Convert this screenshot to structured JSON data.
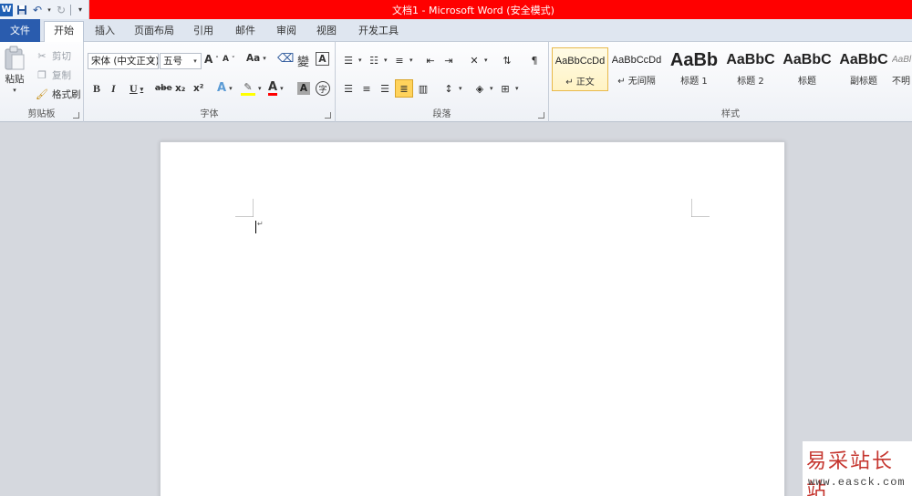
{
  "window": {
    "title": "文档1  -  Microsoft Word (安全模式)",
    "logo_letter": "W",
    "title_bar_color": "#ff0000"
  },
  "tabs": {
    "file": "文件",
    "home": "开始",
    "insert": "插入",
    "layout": "页面布局",
    "references": "引用",
    "mailings": "邮件",
    "review": "审阅",
    "view": "视图",
    "developer": "开发工具"
  },
  "clipboard": {
    "paste": "粘贴",
    "cut": "剪切",
    "copy": "复制",
    "format_painter": "格式刷",
    "label": "剪贴板"
  },
  "font": {
    "family": "宋体 (中文正文)",
    "size": "五号",
    "grow": "A",
    "shrink": "A",
    "case": "Aa",
    "bold": "B",
    "italic": "I",
    "underline": "U",
    "strike": "abe",
    "subscript": "x₂",
    "superscript": "x²",
    "effects": "A",
    "font_color": "A",
    "char_shading": "A",
    "enclose": "字",
    "phonetic": "變",
    "label": "字体"
  },
  "paragraph": {
    "label": "段落"
  },
  "styles": {
    "items": [
      {
        "preview": "AaBbCcDd",
        "name": "↵ 正文"
      },
      {
        "preview": "AaBbCcDd",
        "name": "↵ 无间隔"
      },
      {
        "preview": "AaBb",
        "name": "标题 1"
      },
      {
        "preview": "AaBbC",
        "name": "标题 2"
      },
      {
        "preview": "AaBbC",
        "name": "标题"
      },
      {
        "preview": "AaBbC",
        "name": "副标题"
      },
      {
        "preview": "AaBl",
        "name": "不明"
      }
    ],
    "label": "样式"
  },
  "document": {
    "paragraph_mark": "↵"
  },
  "watermark": {
    "brand": "易采站长站",
    "url": "www.easck.com"
  }
}
